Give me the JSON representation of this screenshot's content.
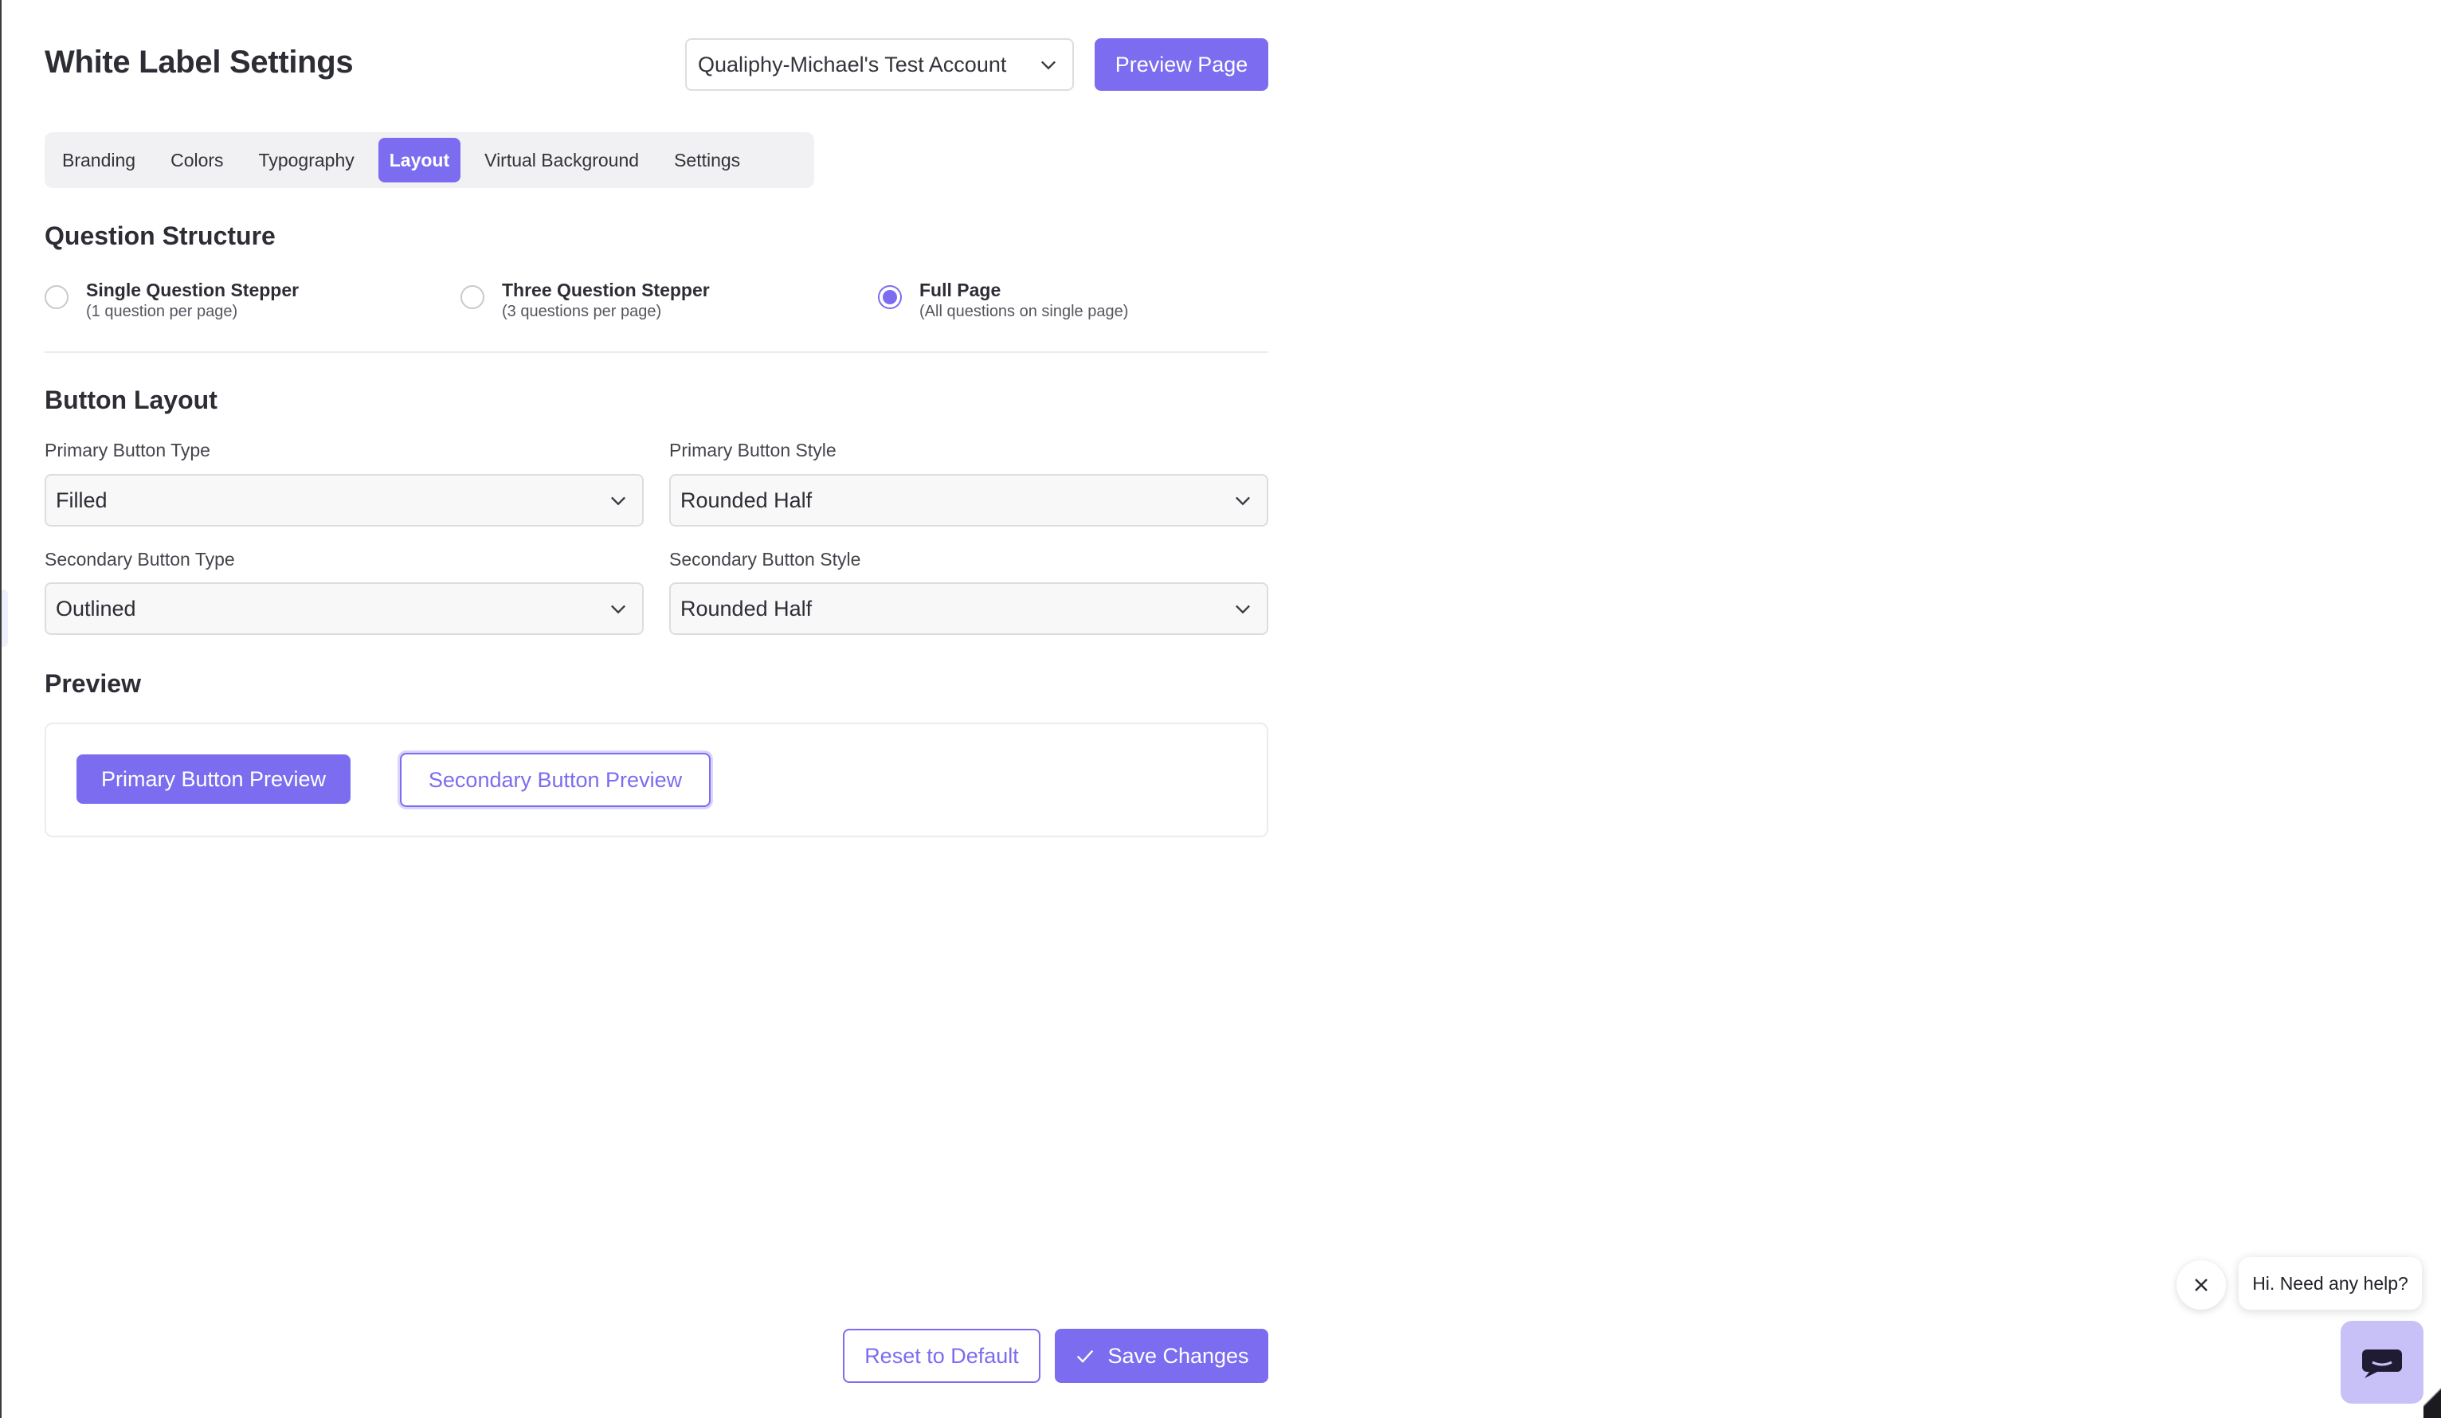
{
  "header": {
    "title": "White Label Settings",
    "account_selected": "Qualiphy-Michael's Test Account",
    "preview_button": "Preview Page"
  },
  "tabs": [
    {
      "label": "Branding",
      "active": false
    },
    {
      "label": "Colors",
      "active": false
    },
    {
      "label": "Typography",
      "active": false
    },
    {
      "label": "Layout",
      "active": true
    },
    {
      "label": "Virtual Background",
      "active": false
    },
    {
      "label": "Settings",
      "active": false
    }
  ],
  "question_structure": {
    "title": "Question Structure",
    "options": [
      {
        "label": "Single Question Stepper",
        "sub": "(1 question per page)",
        "checked": false
      },
      {
        "label": "Three Question Stepper",
        "sub": "(3 questions per page)",
        "checked": false
      },
      {
        "label": "Full Page",
        "sub": "(All questions on single page)",
        "checked": true
      }
    ]
  },
  "button_layout": {
    "title": "Button Layout",
    "primary_type": {
      "label": "Primary Button Type",
      "value": "Filled"
    },
    "primary_style": {
      "label": "Primary Button Style",
      "value": "Rounded Half"
    },
    "secondary_type": {
      "label": "Secondary Button Type",
      "value": "Outlined"
    },
    "secondary_style": {
      "label": "Secondary Button Style",
      "value": "Rounded Half"
    }
  },
  "preview": {
    "title": "Preview",
    "primary_label": "Primary Button Preview",
    "secondary_label": "Secondary Button Preview"
  },
  "footer": {
    "reset_label": "Reset to Default",
    "save_label": "Save Changes"
  },
  "chat": {
    "bubble_text": "Hi. Need any help?"
  },
  "colors": {
    "accent": "#7b6cf0",
    "launcher": "#c8c1f8"
  },
  "icons": [
    "chevron-down-icon",
    "check-icon",
    "close-icon",
    "chat-icon"
  ]
}
